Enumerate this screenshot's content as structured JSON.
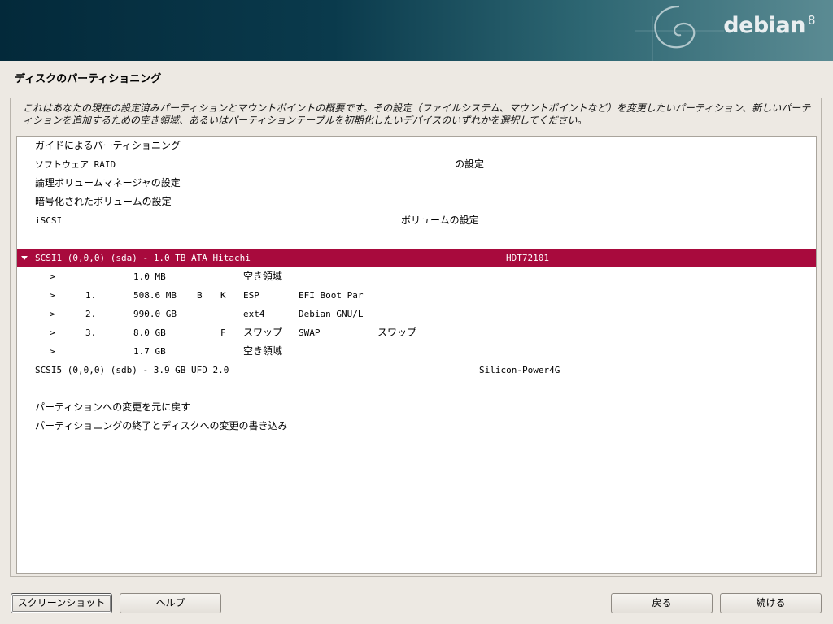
{
  "banner": {
    "logo_text": "debian",
    "logo_version": "8"
  },
  "page_title": "ディスクのパーティショニング",
  "description": "これはあなたの現在の設定済みパーティションとマウントポイントの概要です。その設定（ファイルシステム、マウントポイントなど）を変更したいパーティション、新しいパーティションを追加するための空き領域、あるいはパーティションテーブルを初期化したいデバイスのいずれかを選択してください。",
  "menu": {
    "guided": "ガイドによるパーティショニング",
    "raid_a": "ソフトウェア RAID",
    "raid_b": "の設定",
    "lvm": "論理ボリュームマネージャの設定",
    "crypto": "暗号化されたボリュームの設定",
    "iscsi_a": "iSCSI",
    "iscsi_b": "ボリュームの設定"
  },
  "disk1": {
    "label": "SCSI1 (0,0,0) (sda) - 1.0 TB ATA Hitachi",
    "model": "HDT72101",
    "partitions": [
      {
        "arrow": ">",
        "num": "",
        "size": "1.0  MB",
        "flag1": "",
        "flag2": "",
        "type": "空き領域",
        "name": "",
        "mount": ""
      },
      {
        "arrow": ">",
        "num": "1.",
        "size": "508.6 MB",
        "flag1": "B",
        "flag2": "K",
        "type": "ESP",
        "name": "EFI Boot Par",
        "mount": ""
      },
      {
        "arrow": ">",
        "num": "2.",
        "size": "990.0 GB",
        "flag1": "",
        "flag2": "",
        "type": "ext4",
        "name": "Debian GNU/L",
        "mount": ""
      },
      {
        "arrow": ">",
        "num": "3.",
        "size": "8.0  GB",
        "flag1": "",
        "flag2": "F",
        "type": "スワップ",
        "name": "SWAP",
        "mount": "スワップ"
      },
      {
        "arrow": ">",
        "num": "",
        "size": "1.7  GB",
        "flag1": "",
        "flag2": "",
        "type": "空き領域",
        "name": "",
        "mount": ""
      }
    ]
  },
  "disk2": {
    "label": "SCSI5 (0,0,0) (sdb) - 3.9 GB UFD 2.0",
    "model": "Silicon-Power4G"
  },
  "actions": {
    "undo": "パーティションへの変更を元に戻す",
    "finish": "パーティショニングの終了とディスクへの変更の書き込み"
  },
  "buttons": {
    "screenshot": "スクリーンショット",
    "help": "ヘルプ",
    "back": "戻る",
    "continue": "続ける"
  }
}
